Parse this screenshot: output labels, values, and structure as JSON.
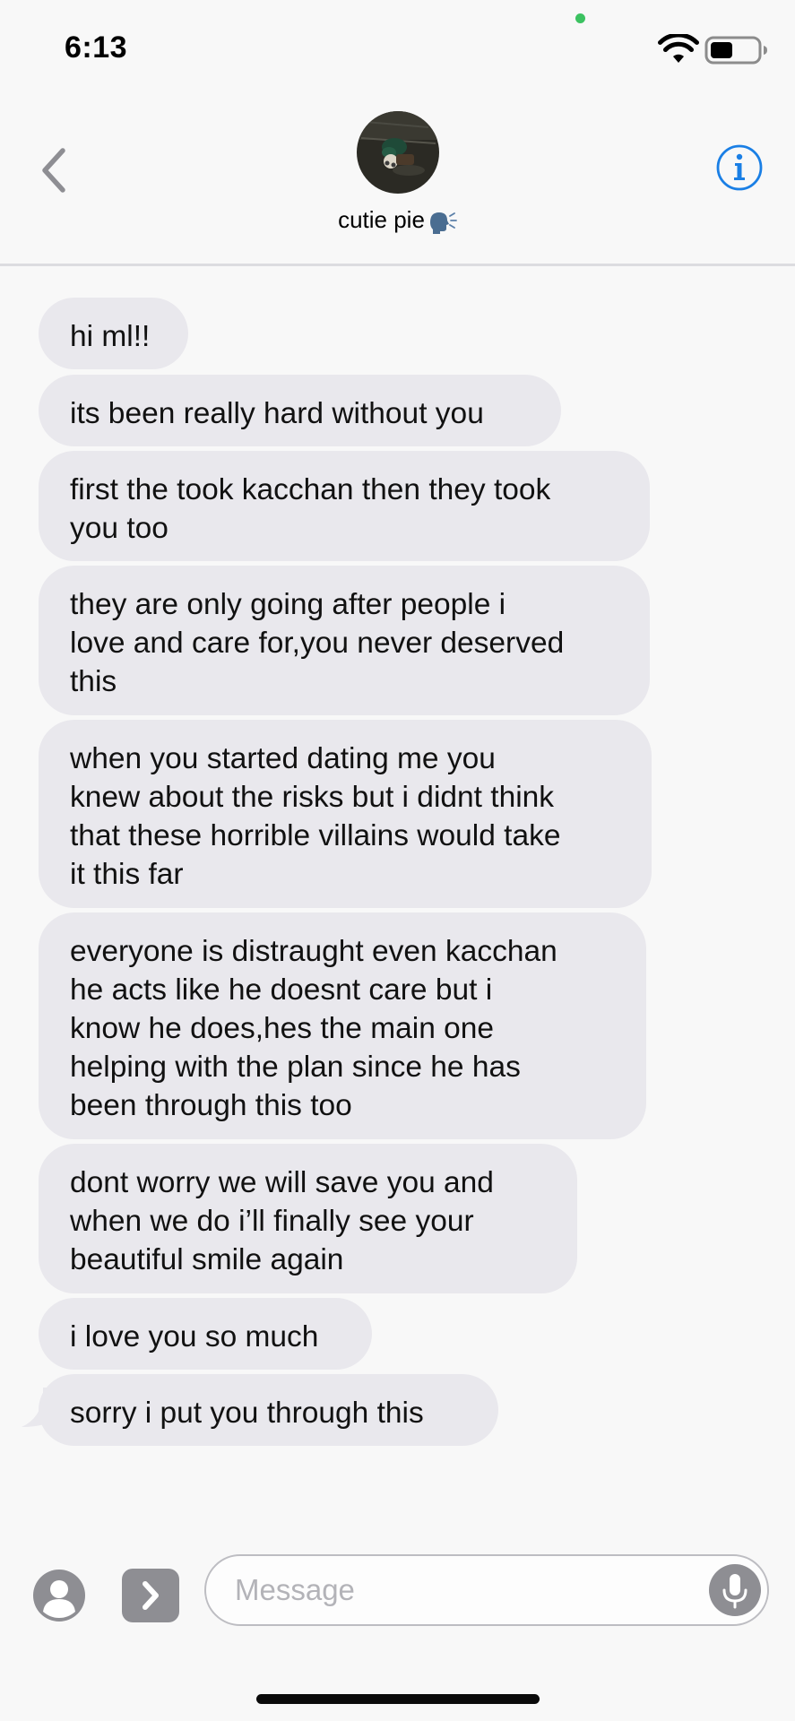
{
  "status_bar": {
    "time": "6:13"
  },
  "header": {
    "contact_name": "cutie pie",
    "speaking_icon": "speaking-head-icon",
    "back_icon": "chevron-left-icon",
    "info_icon": "info-icon"
  },
  "messages": [
    {
      "lines": [
        "hi ml!!"
      ]
    },
    {
      "lines": [
        "its been really hard without you"
      ]
    },
    {
      "lines": [
        "first the took kacchan then they took",
        "you too"
      ]
    },
    {
      "lines": [
        "they are only going after people i",
        "love and care for,you never deserved",
        "this"
      ]
    },
    {
      "lines": [
        "when you started dating me you",
        "knew about the risks but i didnt think",
        "that these horrible villains would take",
        "it this far"
      ]
    },
    {
      "lines": [
        "everyone is distraught even kacchan",
        "he acts like he doesnt care but i",
        "know he does,hes the main one",
        "helping with the plan since he has",
        "been through this too"
      ]
    },
    {
      "lines": [
        "dont worry we will save you and",
        "when we do i’ll finally see your",
        "beautiful smile again"
      ]
    },
    {
      "lines": [
        "i love you so much"
      ]
    },
    {
      "lines": [
        "sorry i put you through this"
      ]
    }
  ],
  "input_bar": {
    "placeholder": "Message",
    "value": ""
  },
  "colors": {
    "accent": "#1a7fe5",
    "bubble_received": "#e9e8ed",
    "background": "#f8f8f8",
    "icon_gray": "#8e8e93"
  }
}
